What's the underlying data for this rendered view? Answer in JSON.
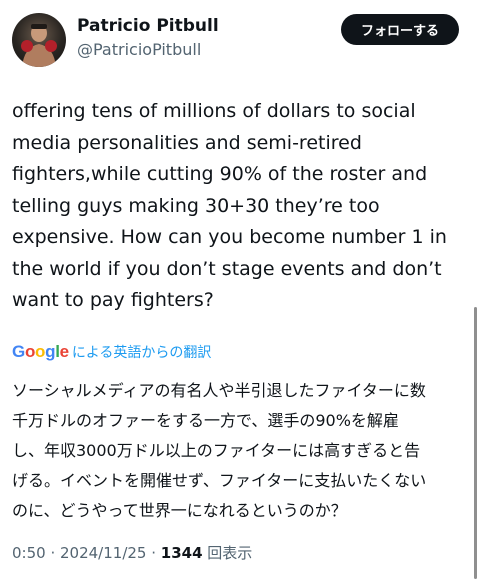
{
  "profile": {
    "name": "Patricio Pitbull",
    "handle": "@PatricioPitbull"
  },
  "follow_button": {
    "label": "フォローする"
  },
  "tweet": {
    "text": "offering tens of millions of dollars to social\nmedia personalities and semi-retired\nfighters,while cutting 90% of the roster and\ntelling guys making 30+30 they’re too\nexpensive. How can you become number 1 in\nthe world if you don’t stage events and don’t\nwant to pay fighters?"
  },
  "translation": {
    "provider_logo": "Google",
    "label": "による英語からの翻訳",
    "text": "ソーシャルメディアの有名人や半引退したファイターに数\n千万ドルのオファーをする一方で、選手の90%を解雇\nし、年収3000万ドル以上のファイターには高すぎると告\nげる。イベントを開催せず、ファイターに支払いたくない\nのに、どうやって世界一になれるというのか？"
  },
  "meta": {
    "time": "0:50",
    "separator1": " · ",
    "date": "2024/11/25",
    "separator2": " · ",
    "views_count": "1344",
    "views_label": " 回表示"
  },
  "colors": {
    "link_blue": "#1d9bf0",
    "secondary_text": "#536471",
    "primary_text": "#0f1419"
  },
  "icons": {
    "avatar": "fighter-photo-avatar"
  }
}
